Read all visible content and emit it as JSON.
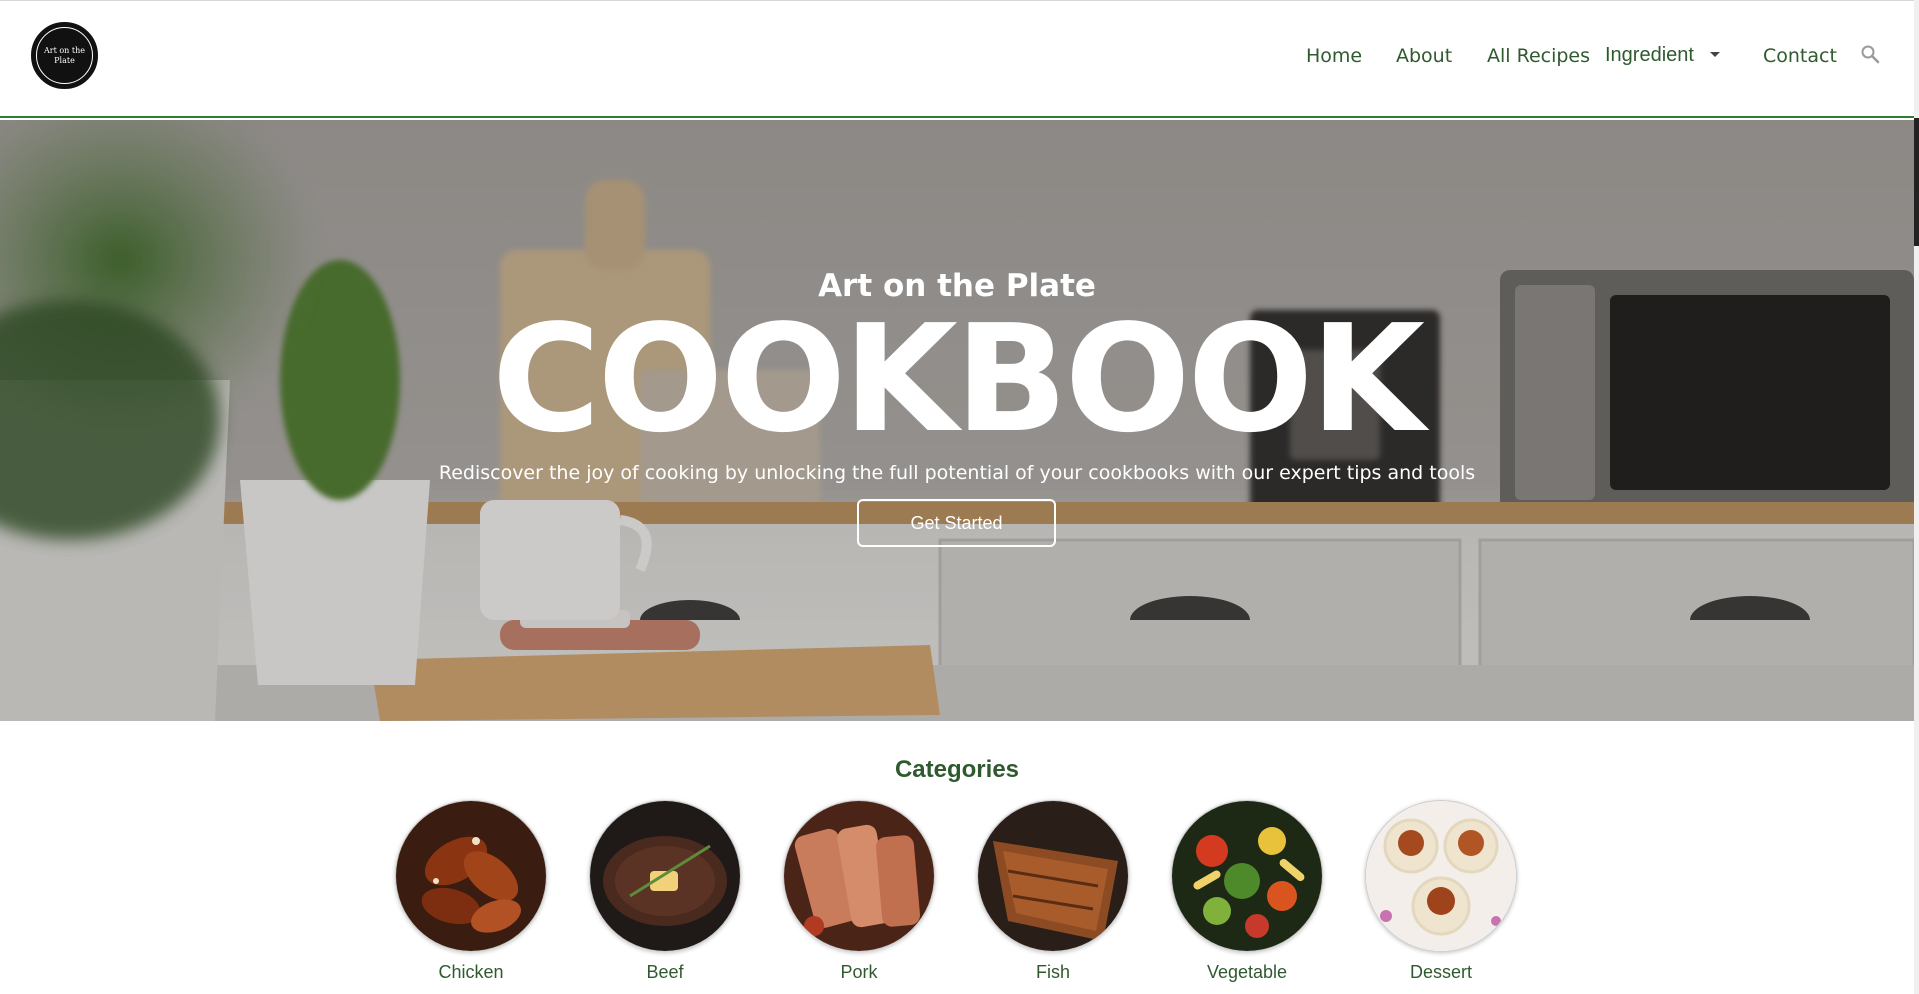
{
  "logo": {
    "line1": "Art on the",
    "line2": "Plate"
  },
  "nav": {
    "home": "Home",
    "about": "About",
    "all_recipes": "All Recipes",
    "ingredient": "Ingredient",
    "contact": "Contact",
    "search_icon": "search-icon"
  },
  "hero": {
    "subtitle": "Art on the Plate",
    "title": "COOKBOOK",
    "tagline": "Rediscover the joy of cooking by unlocking the full potential of your cookbooks with our expert tips and tools",
    "button_label": "Get Started"
  },
  "categories": {
    "title": "Categories",
    "items": [
      {
        "label": "Chicken"
      },
      {
        "label": "Beef"
      },
      {
        "label": "Pork"
      },
      {
        "label": "Fish"
      },
      {
        "label": "Vegetable"
      },
      {
        "label": "Dessert"
      }
    ]
  },
  "colors": {
    "accent": "#2f5a2f",
    "header_border": "#2e7d32"
  }
}
